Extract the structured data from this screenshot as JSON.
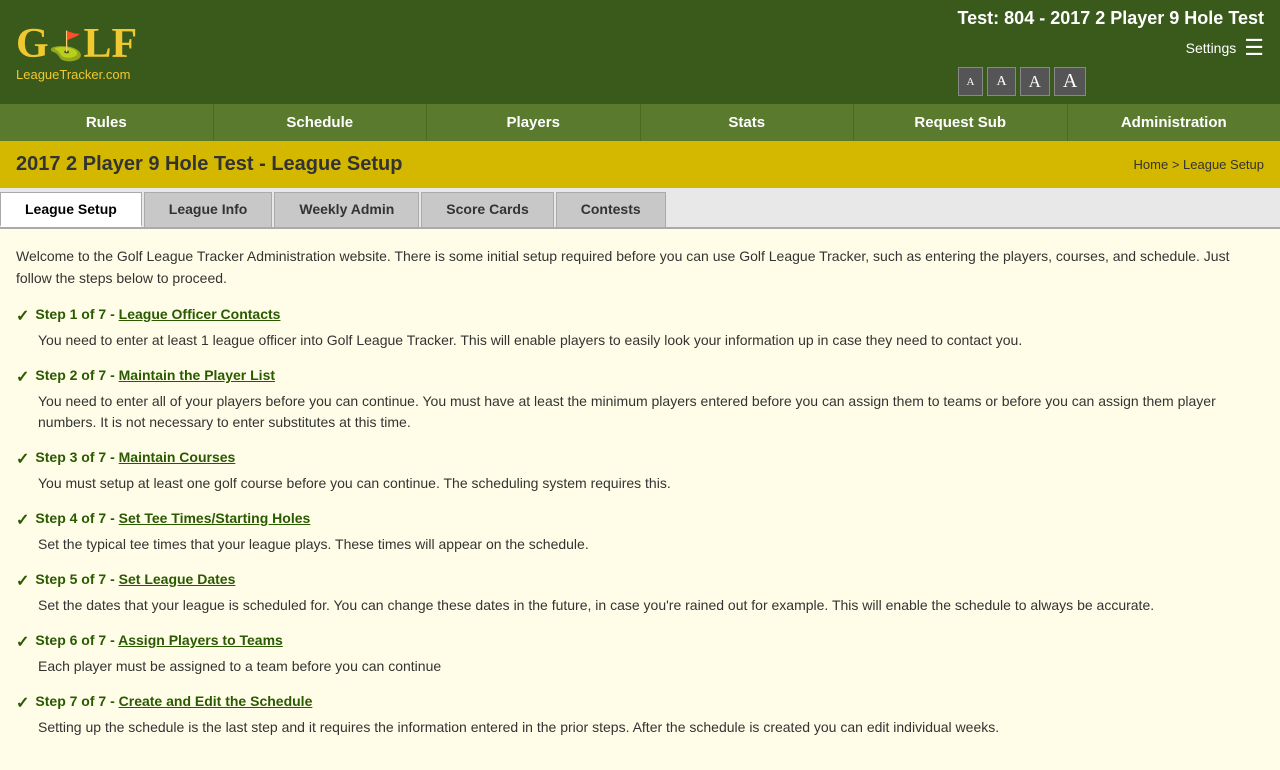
{
  "header": {
    "logo_text": "GULF",
    "logo_sub": "LeagueTracker.com",
    "test_title": "Test: 804 - 2017 2 Player 9 Hole Test",
    "settings_label": "Settings",
    "font_buttons": [
      "A",
      "A",
      "A",
      "A"
    ]
  },
  "nav": {
    "items": [
      {
        "label": "Rules"
      },
      {
        "label": "Schedule"
      },
      {
        "label": "Players"
      },
      {
        "label": "Stats"
      },
      {
        "label": "Request Sub"
      },
      {
        "label": "Administration"
      }
    ]
  },
  "page_title": "2017 2 Player 9 Hole Test - League Setup",
  "breadcrumb": {
    "home": "Home",
    "separator": " > ",
    "current": "League Setup"
  },
  "tabs": [
    {
      "label": "League Setup",
      "active": true
    },
    {
      "label": "League Info",
      "active": false
    },
    {
      "label": "Weekly Admin",
      "active": false
    },
    {
      "label": "Score Cards",
      "active": false
    },
    {
      "label": "Contests",
      "active": false
    }
  ],
  "intro": "Welcome to the Golf League Tracker Administration website.  There is some initial setup required before you can use Golf League Tracker, such as entering the players, courses, and schedule.  Just follow the steps below to proceed.",
  "steps": [
    {
      "id": 1,
      "title": "Step 1 of 7 - League Officer Contacts",
      "desc": "You need to enter at least 1 league officer into Golf League Tracker.  This will enable players to easily look your information up in case they need to contact you."
    },
    {
      "id": 2,
      "title": "Step 2 of 7 - Maintain the Player List",
      "desc": "You need to enter all of your players before you can continue.  You must have at least the minimum players entered before you can assign them to teams or before you can assign them player numbers.  It is not necessary to enter substitutes at this time."
    },
    {
      "id": 3,
      "title": "Step 3 of 7 - Maintain Courses",
      "desc": "You must setup at least one golf course before you can continue.  The scheduling system requires this."
    },
    {
      "id": 4,
      "title": "Step 4 of 7 - Set Tee Times/Starting Holes",
      "desc": "Set the typical tee times that your league plays. These times will appear on the schedule."
    },
    {
      "id": 5,
      "title": "Step 5 of 7 - Set League Dates",
      "desc": "Set the dates that your league is scheduled for.  You can change these dates in the future, in case you're rained out for example.  This will enable the schedule to always be accurate."
    },
    {
      "id": 6,
      "title": "Step 6 of 7 - Assign Players to Teams",
      "desc": "Each player must be assigned to a team before you can continue"
    },
    {
      "id": 7,
      "title": "Step 7 of 7 - Create and Edit the Schedule",
      "desc": "Setting up the schedule is the last step and it requires the information entered in the prior steps. After the schedule is created you can edit individual weeks."
    }
  ]
}
